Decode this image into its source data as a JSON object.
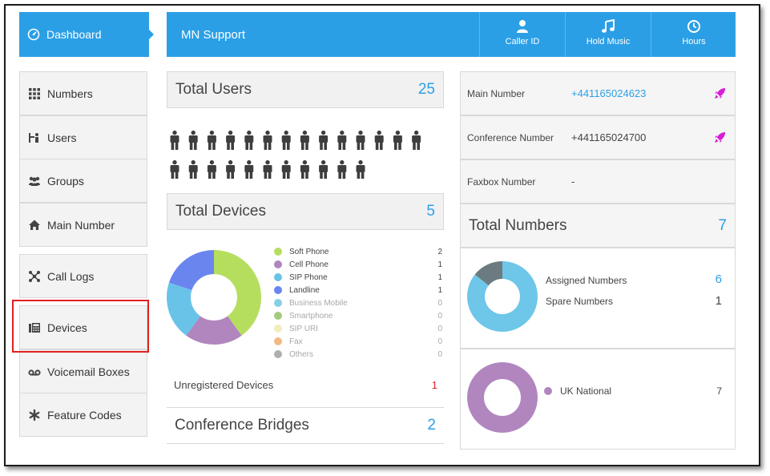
{
  "nav": {
    "dashboard_label": "Dashboard",
    "brand": "MN Support",
    "toolbar": [
      {
        "label": "Caller ID",
        "icon": "user-icon"
      },
      {
        "label": "Hold Music",
        "icon": "music-note-icon"
      },
      {
        "label": "Hours",
        "icon": "clock-icon"
      }
    ]
  },
  "sidebar": {
    "items": [
      {
        "label": "Numbers",
        "icon": "grid-icon"
      },
      {
        "label": "Users",
        "icon": "users-icon"
      },
      {
        "label": "Groups",
        "icon": "group-icon"
      },
      {
        "label": "Main Number",
        "icon": "home-icon"
      },
      {
        "label": "Call Logs",
        "icon": "call-logs-icon"
      },
      {
        "label": "Devices",
        "icon": "phone-device-icon"
      },
      {
        "label": "Voicemail Boxes",
        "icon": "voicemail-icon"
      },
      {
        "label": "Feature Codes",
        "icon": "asterisk-icon"
      }
    ]
  },
  "users": {
    "title": "Total Users",
    "count": "25"
  },
  "devices": {
    "title": "Total Devices",
    "count": "5",
    "unregistered_label": "Unregistered Devices",
    "unregistered_count": "1"
  },
  "conference": {
    "title": "Conference Bridges",
    "count": "2"
  },
  "numbers": {
    "main_label": "Main Number",
    "main_value": "+441165024623",
    "conference_label": "Conference Number",
    "conference_value": "+441165024700",
    "faxbox_label": "Faxbox Number",
    "faxbox_value": "-",
    "total_title": "Total Numbers",
    "total_count": "7",
    "assigned_label": "Assigned Numbers",
    "assigned_count": "6",
    "spare_label": "Spare Numbers",
    "spare_count": "1",
    "region_label": "UK National",
    "region_count": "7"
  },
  "colors": {
    "brand": "#2b9fe6",
    "alert": "#e02020",
    "rocket": "#d61fd6"
  },
  "chart_data": [
    {
      "type": "pie",
      "categories": [
        "Soft Phone",
        "Cell Phone",
        "SIP Phone",
        "Landline",
        "Business Mobile",
        "Smartphone",
        "SIP URI",
        "Fax",
        "Others"
      ],
      "values": [
        2,
        1,
        1,
        1,
        0,
        0,
        0,
        0,
        0
      ],
      "colors": [
        "#b5de5f",
        "#b186be",
        "#69c3e8",
        "#6a85ee",
        "#87cfe7",
        "#a6ca7d",
        "#f1eebc",
        "#f0ba84",
        "#aeb0b0"
      ],
      "legend": "right"
    },
    {
      "type": "pie",
      "categories": [
        "Assigned Numbers",
        "Spare Numbers"
      ],
      "values": [
        6,
        1
      ],
      "colors": [
        "#6ec6e9",
        "#6b7b7f"
      ]
    },
    {
      "type": "pie",
      "categories": [
        "UK National"
      ],
      "values": [
        7
      ],
      "colors": [
        "#b186be"
      ]
    }
  ]
}
